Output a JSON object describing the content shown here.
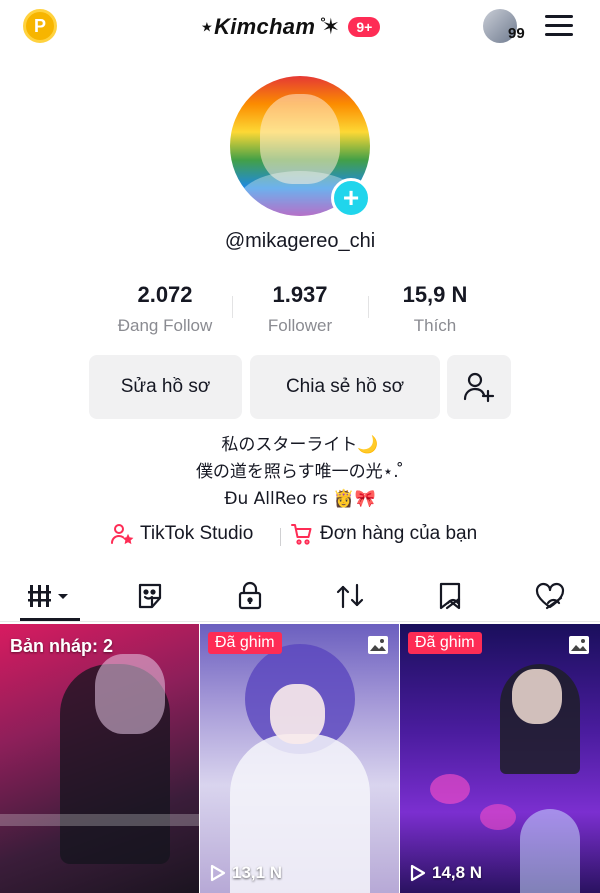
{
  "header": {
    "title": "⋆Kimcham ̊✶",
    "notification_count": "9+",
    "account_badge_count": "99"
  },
  "profile": {
    "username": "@mikagereo_chi",
    "stats": [
      {
        "value": "2.072",
        "label": "Đang Follow"
      },
      {
        "value": "1.937",
        "label": "Follower"
      },
      {
        "value": "15,9 N",
        "label": "Thích"
      }
    ],
    "buttons": {
      "edit": "Sửa hồ sơ",
      "share": "Chia sẻ hồ sơ"
    },
    "bio": [
      "私のスターライト🌙",
      "僕の道を照らす唯一の光⋆. ̊",
      "Đu AllReo rs 👸🎀"
    ],
    "links": {
      "studio": "TikTok Studio",
      "orders": "Đơn hàng của bạn"
    }
  },
  "grid": {
    "draft_label": "Bản nháp: 2",
    "items": [
      {
        "pinned": "Đã ghim",
        "views": "13,1 N"
      },
      {
        "pinned": "Đã ghim",
        "views": "14,8 N"
      }
    ]
  },
  "colors": {
    "accent": "#fe2c55",
    "add_button": "#20d5ec",
    "coin": "#f7b500"
  }
}
